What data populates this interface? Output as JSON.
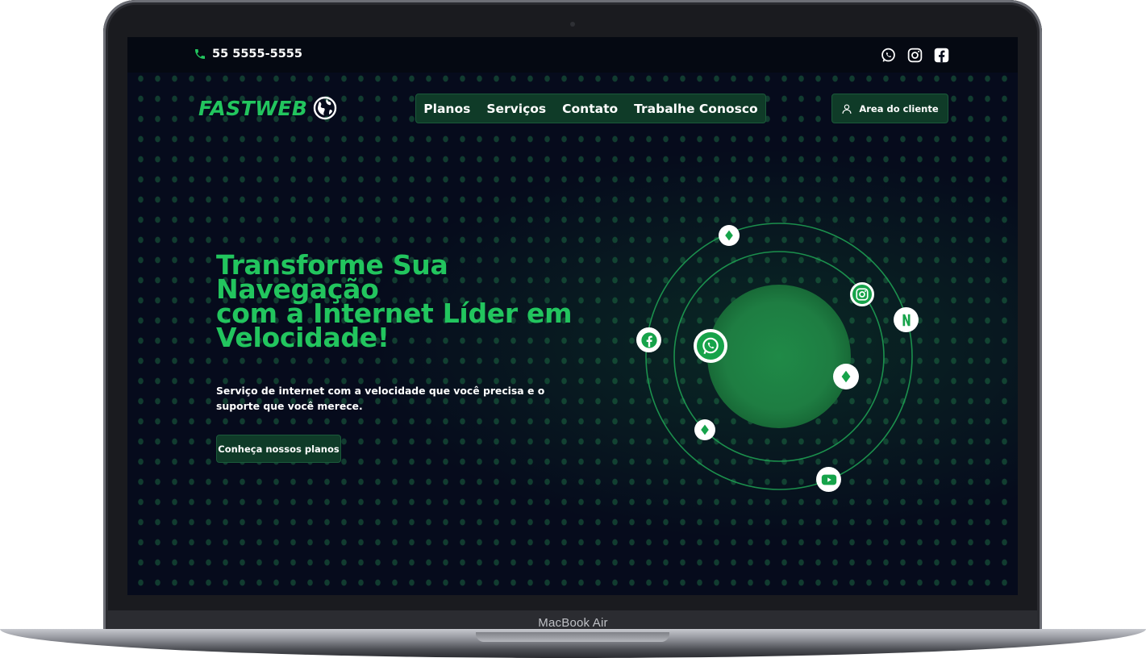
{
  "device": {
    "label": "MacBook Air"
  },
  "topbar": {
    "phone": "55 5555-5555",
    "social_icons": [
      "whatsapp-icon",
      "instagram-icon",
      "facebook-icon"
    ]
  },
  "header": {
    "logo_text": "FASTWEB",
    "nav": [
      {
        "label": "Planos"
      },
      {
        "label": "Serviços"
      },
      {
        "label": "Contato"
      },
      {
        "label": "Trabalhe Conosco"
      }
    ],
    "client_area_label": "Area do cliente"
  },
  "hero": {
    "title_lines": [
      "Transforme Sua",
      "Navegação",
      "com a Internet Líder em",
      "Velocidade!"
    ],
    "subtitle_lines": [
      "Serviço de internet com a velocidade que você precisa e o",
      "suporte que você merece."
    ],
    "cta_label": "Conheça nossos planos"
  },
  "orbit": {
    "icons": [
      "diamond-icon",
      "instagram-icon",
      "netflix-icon",
      "facebook-icon",
      "whatsapp-icon",
      "diamond-icon",
      "diamond-icon",
      "youtube-icon"
    ]
  },
  "colors": {
    "accent": "#22c55e",
    "background": "#060b1c",
    "button_bg": "#0f3b28",
    "planet": "#1f7a40"
  }
}
